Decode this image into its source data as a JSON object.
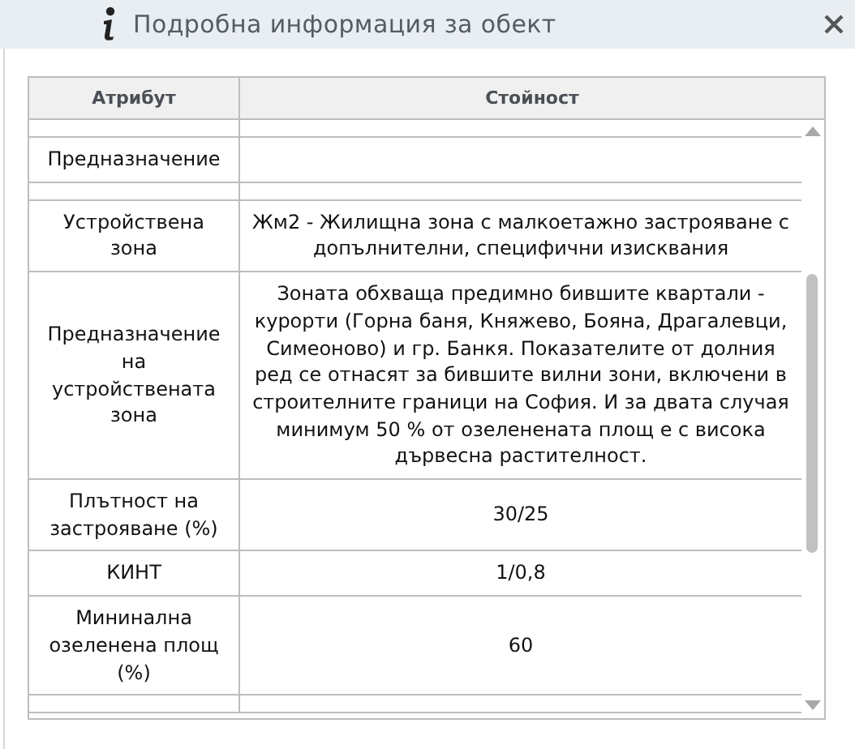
{
  "window": {
    "title": "Подробна информация за обект"
  },
  "table": {
    "columns": [
      "Атрибут",
      "Стойност"
    ],
    "rows": [
      {
        "kind": "blank"
      },
      {
        "kind": "data",
        "attribute": "Предназначение"
      },
      {
        "kind": "blank"
      },
      {
        "kind": "data",
        "attribute": "Устройствена зона",
        "value": "Жм2 - Жилищна зона с малкоетажно застрояване с допълнителни, специфични изисквания"
      },
      {
        "kind": "data",
        "attribute": "Предназначение на устройствената зона",
        "value": "Зоната обхваща предимно бившите квартали - курорти (Горна баня, Княжево, Бояна, Драгалевци, Симеоново) и гр. Банкя. Показателите от долния ред се отнасят за бившите вилни зони, включени в строителните граници на София. И за двата случая минимум 50 % от озеленената площ е с висока дървесна растителност."
      },
      {
        "kind": "data",
        "attribute": "Плътност на застрояване (%)",
        "value": "30/25"
      },
      {
        "kind": "data",
        "attribute": "КИНТ",
        "value": "1/0,8"
      },
      {
        "kind": "data",
        "attribute": "Мининална озеленена площ (%)",
        "value": "60"
      },
      {
        "kind": "blank"
      }
    ]
  }
}
